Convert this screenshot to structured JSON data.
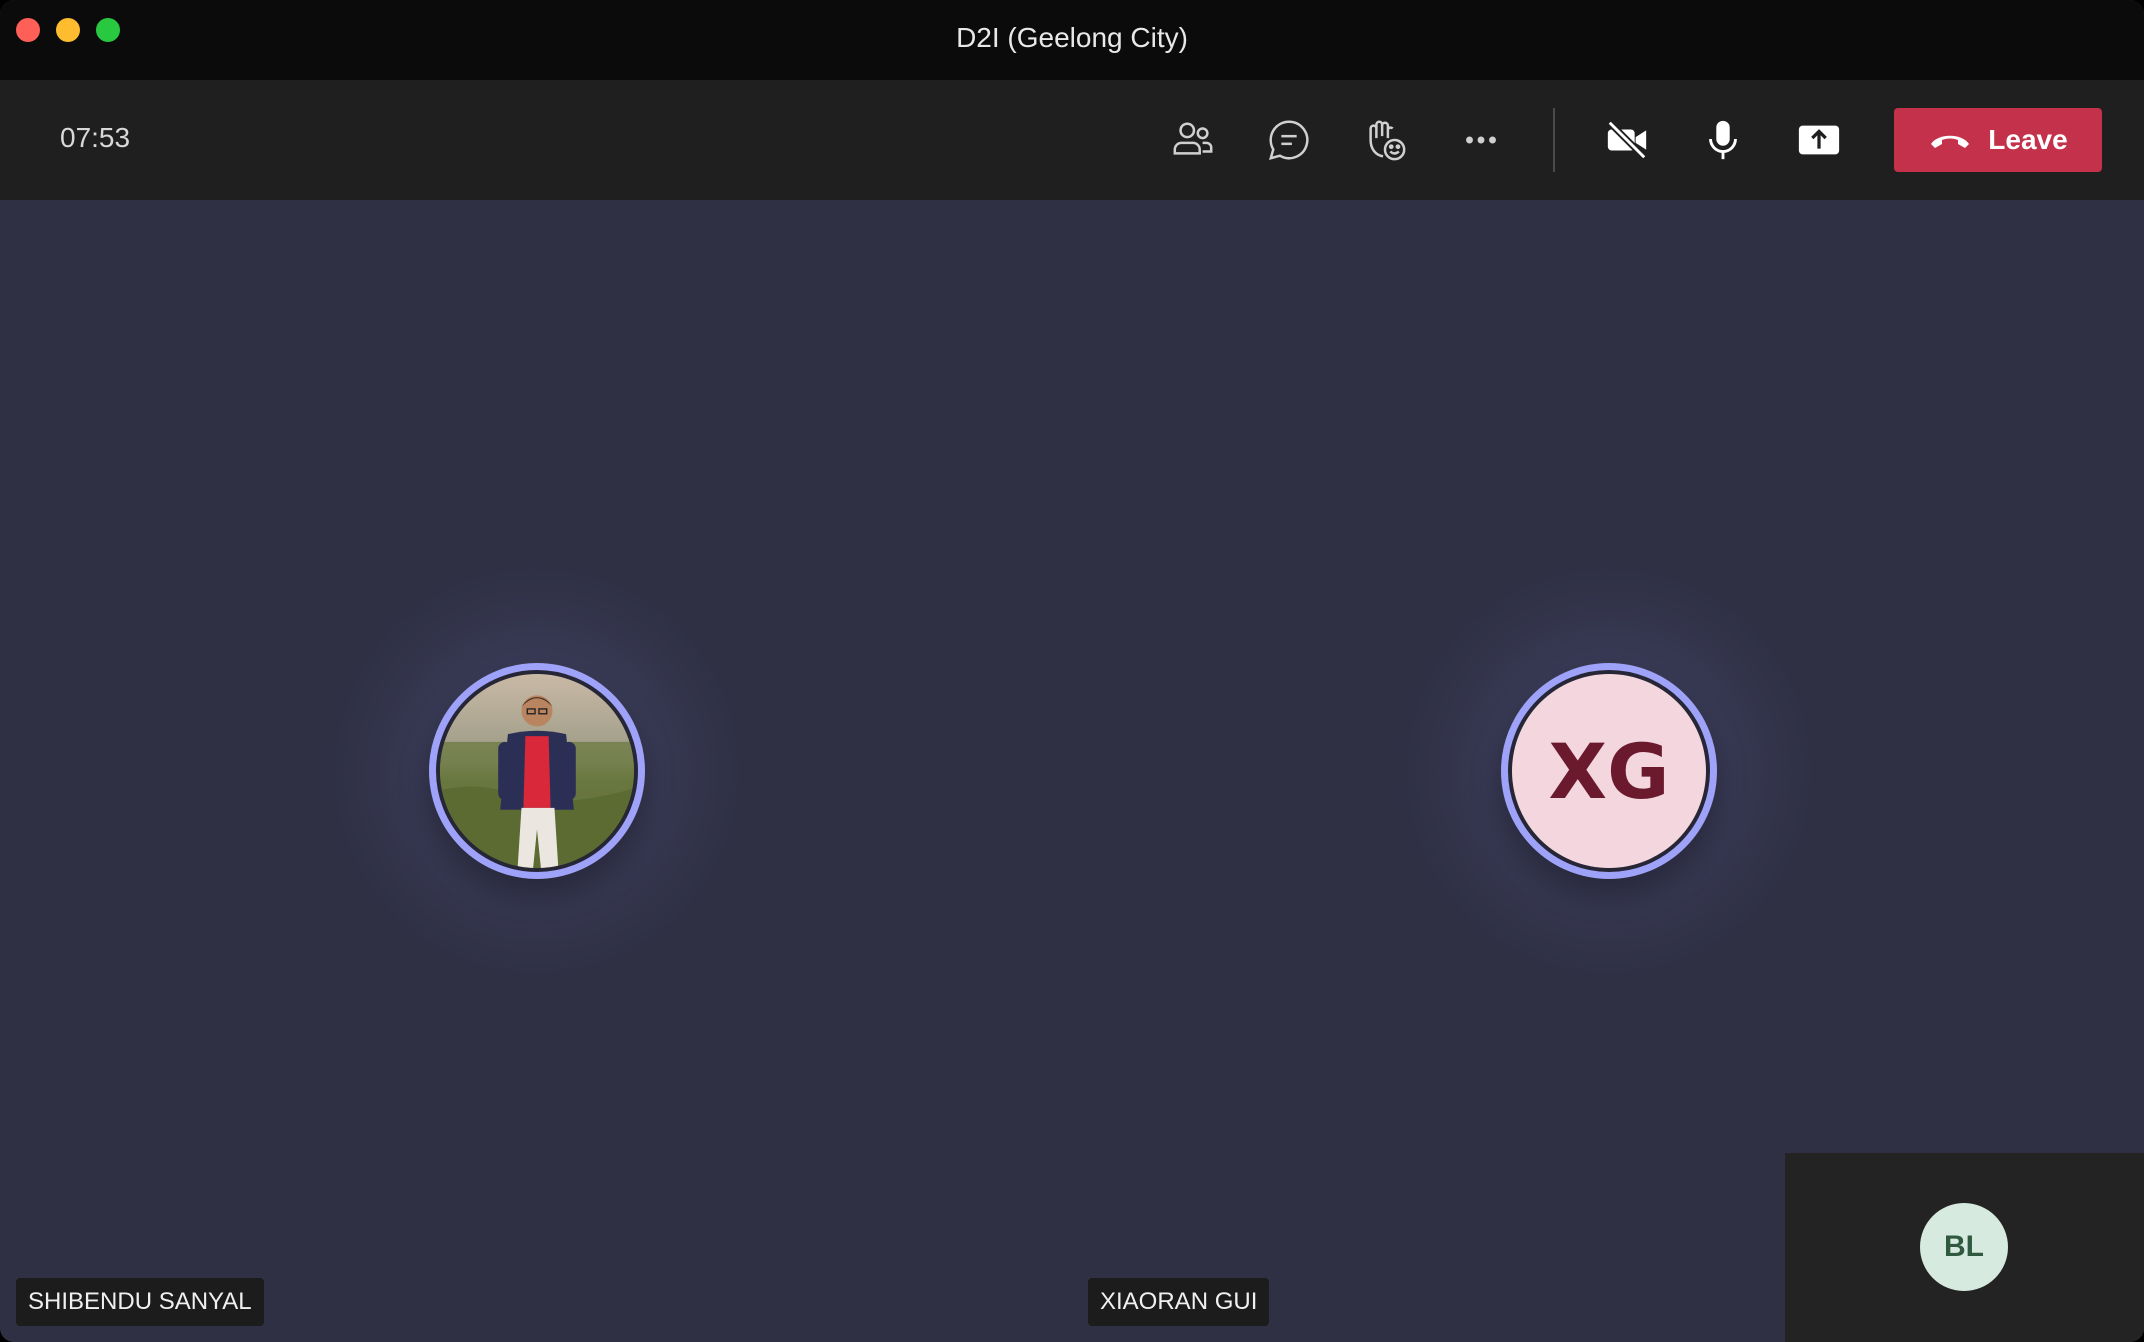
{
  "window": {
    "title": "D2I (Geelong City)"
  },
  "toolbar": {
    "timer": "07:53",
    "icons": [
      "people-icon",
      "chat-icon",
      "reactions-icon",
      "more-icon",
      "camera-off-icon",
      "microphone-icon",
      "share-icon",
      "phone-hangup-icon"
    ],
    "leave_label": "Leave",
    "leave_color": "#c4314b"
  },
  "participants": [
    {
      "name": "SHIBENDU SANYAL",
      "avatar": "photo"
    },
    {
      "name": "XIAORAN GUI",
      "initials": "XG",
      "avatar_color": "#f3d6de"
    }
  ],
  "self_view": {
    "initials": "BL",
    "avatar_color": "#d7eadf"
  },
  "colors": {
    "stage": "#2f3044",
    "ring": "#9ea2f8"
  }
}
